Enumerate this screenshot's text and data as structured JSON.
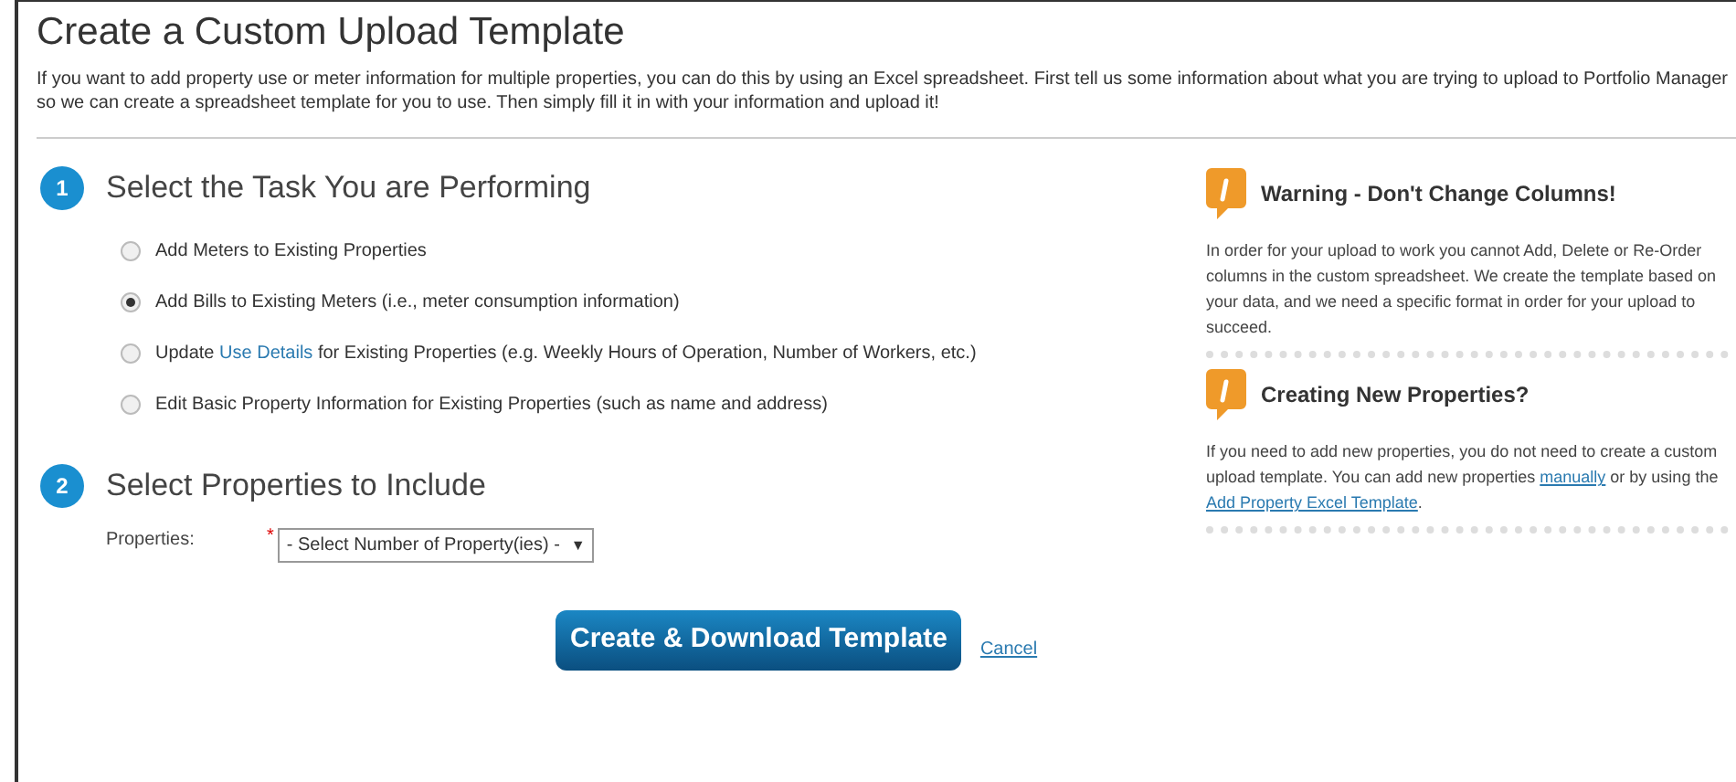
{
  "title": "Create a Custom Upload Template",
  "intro": "If you want to add property use or meter information for multiple properties, you can do this by using an Excel spreadsheet. First tell us some information about what you are trying to upload to Portfolio Manager so we can create a spreadsheet template for you to use. Then simply fill it in with your information and upload it!",
  "steps": [
    {
      "number": "1",
      "heading": "Select the Task You are Performing"
    },
    {
      "number": "2",
      "heading": "Select Properties to Include"
    }
  ],
  "task_options": [
    {
      "selected": false,
      "parts": [
        {
          "text": "Add Meters to Existing Properties"
        }
      ]
    },
    {
      "selected": true,
      "parts": [
        {
          "text": "Add Bills to Existing Meters (i.e., meter consumption information)"
        }
      ]
    },
    {
      "selected": false,
      "parts": [
        {
          "text": "Update "
        },
        {
          "link": "Use Details"
        },
        {
          "text": " for Existing Properties (e.g. Weekly Hours of Operation, Number of Workers, etc.)"
        }
      ]
    },
    {
      "selected": false,
      "parts": [
        {
          "text": "Edit Basic Property Information for Existing Properties (such as name and address)"
        }
      ]
    }
  ],
  "properties_field": {
    "label": "Properties:",
    "required_mark": "*",
    "value": "- Select Number of Property(ies) -",
    "caret": "▼"
  },
  "buttons": {
    "primary": "Create & Download Template",
    "cancel": "Cancel"
  },
  "notes": [
    {
      "title": "Warning - Don't Change Columns!",
      "parts": [
        {
          "text": "In order for your upload to work you cannot Add, Delete or Re-Order columns in the custom spreadsheet. We create the template based on your data, and we need a specific format in order for your upload to succeed."
        }
      ]
    },
    {
      "title": "Creating New Properties?",
      "parts": [
        {
          "text": "If you need to add new properties, you do not need to create a custom upload template. You can add new properties "
        },
        {
          "link": "manually"
        },
        {
          "text": " or by using the "
        },
        {
          "link": "Add Property Excel Template"
        },
        {
          "text": "."
        }
      ]
    }
  ]
}
